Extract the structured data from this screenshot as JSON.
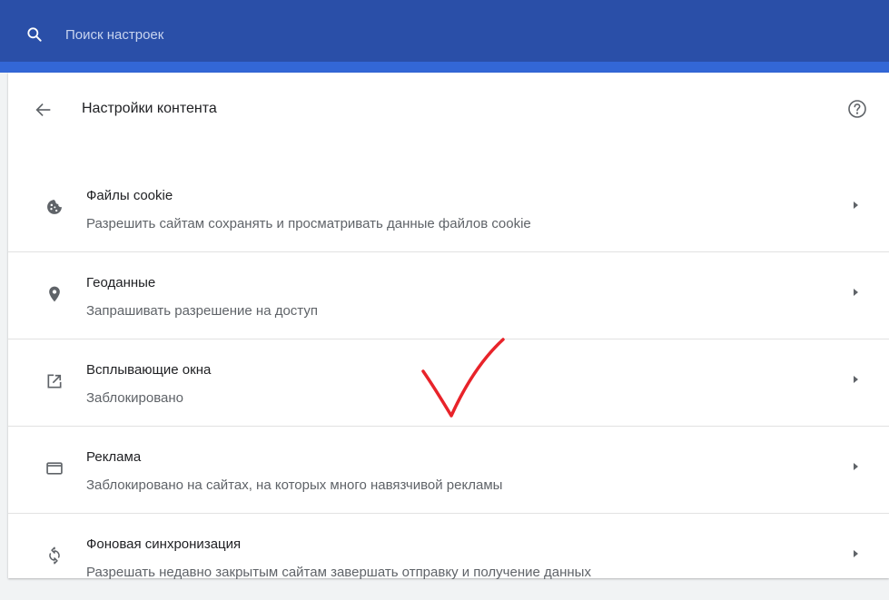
{
  "search": {
    "placeholder": "Поиск настроек"
  },
  "header": {
    "title": "Настройки контента"
  },
  "items": [
    {
      "title": "Файлы cookie",
      "subtitle": "Разрешить сайтам сохранять и просматривать данные файлов cookie",
      "icon": "cookie-icon"
    },
    {
      "title": "Геоданные",
      "subtitle": "Запрашивать разрешение на доступ",
      "icon": "location-pin-icon"
    },
    {
      "title": "Всплывающие окна",
      "subtitle": "Заблокировано",
      "icon": "open-in-new-icon"
    },
    {
      "title": "Реклама",
      "subtitle": "Заблокировано на сайтах, на которых много навязчивой рекламы",
      "icon": "ad-window-icon"
    },
    {
      "title": "Фоновая синхронизация",
      "subtitle": "Разрешать недавно закрытым сайтам завершать отправку и получение данных",
      "icon": "sync-icon"
    }
  ],
  "colors": {
    "topbar": "#2a4fa8",
    "topbar_strip": "#3367d6",
    "checkmark": "#e8232a"
  }
}
